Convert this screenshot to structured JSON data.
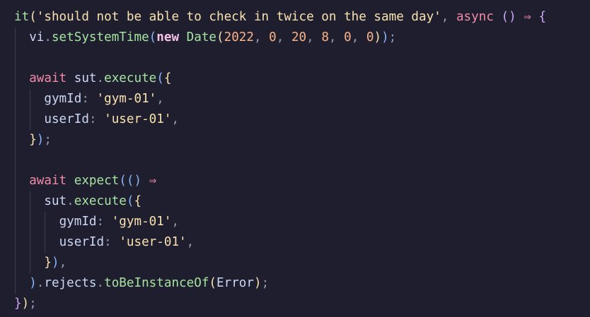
{
  "code": {
    "lines": [
      {
        "indent": 0,
        "tokens": [
          {
            "t": "it",
            "c": "fn"
          },
          {
            "t": "(",
            "c": "b1"
          },
          {
            "t": "'should not be able to check in twice on the same day'",
            "c": "str"
          },
          {
            "t": ", ",
            "c": "punc"
          },
          {
            "t": "async",
            "c": "ar"
          },
          {
            "t": " ",
            "c": "id"
          },
          {
            "t": "()",
            "c": "b2"
          },
          {
            "t": " ⇒ ",
            "c": "kw"
          },
          {
            "t": "{",
            "c": "b2"
          }
        ]
      },
      {
        "indent": 1,
        "tokens": [
          {
            "t": "vi",
            "c": "id"
          },
          {
            "t": ".",
            "c": "punc"
          },
          {
            "t": "setSystemTime",
            "c": "fn"
          },
          {
            "t": "(",
            "c": "b3"
          },
          {
            "t": "new",
            "c": "new"
          },
          {
            "t": " ",
            "c": "id"
          },
          {
            "t": "Date",
            "c": "fn"
          },
          {
            "t": "(",
            "c": "b1"
          },
          {
            "t": "2022",
            "c": "num"
          },
          {
            "t": ", ",
            "c": "punc"
          },
          {
            "t": "0",
            "c": "num"
          },
          {
            "t": ", ",
            "c": "punc"
          },
          {
            "t": "20",
            "c": "num"
          },
          {
            "t": ", ",
            "c": "punc"
          },
          {
            "t": "8",
            "c": "num"
          },
          {
            "t": ", ",
            "c": "punc"
          },
          {
            "t": "0",
            "c": "num"
          },
          {
            "t": ", ",
            "c": "punc"
          },
          {
            "t": "0",
            "c": "num"
          },
          {
            "t": ")",
            "c": "b1"
          },
          {
            "t": ")",
            "c": "b3"
          },
          {
            "t": ";",
            "c": "punc"
          }
        ]
      },
      {
        "indent": 1,
        "tokens": []
      },
      {
        "indent": 1,
        "tokens": [
          {
            "t": "await",
            "c": "kw"
          },
          {
            "t": " sut",
            "c": "id"
          },
          {
            "t": ".",
            "c": "punc"
          },
          {
            "t": "execute",
            "c": "fn"
          },
          {
            "t": "(",
            "c": "b3"
          },
          {
            "t": "{",
            "c": "b1"
          }
        ]
      },
      {
        "indent": 2,
        "tokens": [
          {
            "t": "gymId",
            "c": "id"
          },
          {
            "t": ": ",
            "c": "punc"
          },
          {
            "t": "'gym-01'",
            "c": "str"
          },
          {
            "t": ",",
            "c": "punc"
          }
        ]
      },
      {
        "indent": 2,
        "tokens": [
          {
            "t": "userId",
            "c": "id"
          },
          {
            "t": ": ",
            "c": "punc"
          },
          {
            "t": "'user-01'",
            "c": "str"
          },
          {
            "t": ",",
            "c": "punc"
          }
        ]
      },
      {
        "indent": 1,
        "tokens": [
          {
            "t": "}",
            "c": "b1"
          },
          {
            "t": ")",
            "c": "b3"
          },
          {
            "t": ";",
            "c": "punc"
          }
        ]
      },
      {
        "indent": 1,
        "tokens": []
      },
      {
        "indent": 1,
        "tokens": [
          {
            "t": "await",
            "c": "kw"
          },
          {
            "t": " ",
            "c": "id"
          },
          {
            "t": "expect",
            "c": "fn"
          },
          {
            "t": "(",
            "c": "b3"
          },
          {
            "t": "()",
            "c": "b3"
          },
          {
            "t": " ⇒",
            "c": "kw"
          }
        ]
      },
      {
        "indent": 2,
        "tokens": [
          {
            "t": "sut",
            "c": "id"
          },
          {
            "t": ".",
            "c": "punc"
          },
          {
            "t": "execute",
            "c": "fn"
          },
          {
            "t": "(",
            "c": "b3"
          },
          {
            "t": "{",
            "c": "b1"
          }
        ]
      },
      {
        "indent": 3,
        "tokens": [
          {
            "t": "gymId",
            "c": "id"
          },
          {
            "t": ": ",
            "c": "punc"
          },
          {
            "t": "'gym-01'",
            "c": "str"
          },
          {
            "t": ",",
            "c": "punc"
          }
        ]
      },
      {
        "indent": 3,
        "tokens": [
          {
            "t": "userId",
            "c": "id"
          },
          {
            "t": ": ",
            "c": "punc"
          },
          {
            "t": "'user-01'",
            "c": "str"
          },
          {
            "t": ",",
            "c": "punc"
          }
        ]
      },
      {
        "indent": 2,
        "tokens": [
          {
            "t": "}",
            "c": "b1"
          },
          {
            "t": ")",
            "c": "b3"
          },
          {
            "t": ",",
            "c": "punc"
          }
        ]
      },
      {
        "indent": 1,
        "tokens": [
          {
            "t": ")",
            "c": "b3"
          },
          {
            "t": ".",
            "c": "punc"
          },
          {
            "t": "rejects",
            "c": "id"
          },
          {
            "t": ".",
            "c": "punc"
          },
          {
            "t": "toBeInstanceOf",
            "c": "fn"
          },
          {
            "t": "(",
            "c": "b1"
          },
          {
            "t": "Error",
            "c": "id"
          },
          {
            "t": ")",
            "c": "b1"
          },
          {
            "t": ";",
            "c": "punc"
          }
        ]
      },
      {
        "indent": 0,
        "tokens": [
          {
            "t": "}",
            "c": "b2"
          },
          {
            "t": ")",
            "c": "b1"
          },
          {
            "t": ";",
            "c": "punc"
          }
        ]
      }
    ]
  },
  "colors": {
    "background": "#1e1e2e",
    "text": "#cdd6f4",
    "function": "#a6e3a1",
    "string": "#f9e2af",
    "keyword": "#f38ba8",
    "number": "#fab387",
    "indent_guide": "#3b3d50"
  }
}
